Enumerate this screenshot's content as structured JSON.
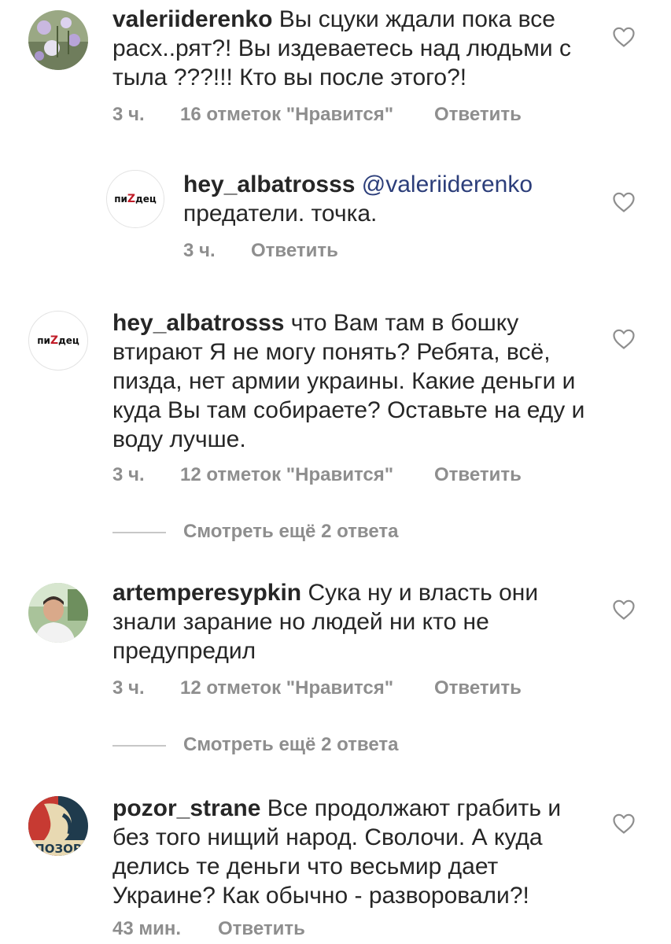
{
  "comments": [
    {
      "username": "valeriiderenko",
      "text": "Вы сцуки ждали пока все расх..рят?! Вы издеваетесь над людьми с тыла ???!!! Кто вы после этого?!",
      "time": "3 ч.",
      "likes": "16 отметок \"Нравится\"",
      "reply": "Ответить",
      "avatar_icon": "photo-avatar-flowers"
    },
    {
      "username": "hey_albatrosss",
      "mention": "@valeriiderenko",
      "text": "предатели. точка.",
      "time": "3 ч.",
      "reply": "Ответить",
      "avatar_logo": {
        "left": "пи",
        "z": "Z",
        "right": "дец"
      }
    },
    {
      "username": "hey_albatrosss",
      "text": "что Вам там в бошку втирают  Я не могу понять? Ребята, всё, пизда, нет армии украины. Какие деньги и куда Вы там собираете? Оставьте на еду и воду лучше.",
      "time": "3 ч.",
      "likes": "12 отметок \"Нравится\"",
      "reply": "Ответить",
      "avatar_logo": {
        "left": "пи",
        "z": "Z",
        "right": "дец"
      }
    },
    {
      "username": "artemperesypkin",
      "text": "Сука ну и власть они знали зарание но людей ни кто не предупредил",
      "time": "3 ч.",
      "likes": "12 отметок \"Нравится\"",
      "reply": "Ответить",
      "avatar_icon": "photo-avatar-man"
    },
    {
      "username": "pozor_strane",
      "text": "Все продолжают грабить и без того нищий народ. Сволочи. А куда делись те деньги что весьмир дает Украине? Как обычно - разворовали?!",
      "time": "43 мин.",
      "reply": "Ответить",
      "avatar_icon": "poster-avatar",
      "avatar_text": "ПОЗОР"
    }
  ],
  "view_more": [
    {
      "label": "Смотреть ещё 2 ответа"
    },
    {
      "label": "Смотреть ещё 2 ответа"
    }
  ],
  "colors": {
    "text": "#262626",
    "muted": "#8e8e8e",
    "mention": "#2c3e7a",
    "logo_z": "#c01c28"
  }
}
